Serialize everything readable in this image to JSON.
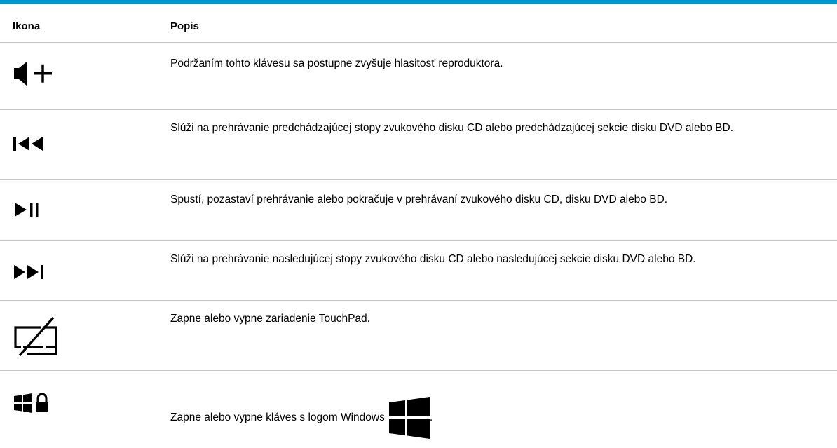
{
  "table": {
    "headers": {
      "icon": "Ikona",
      "description": "Popis"
    },
    "rows": [
      {
        "icon": "volume-up-icon",
        "description": "Podržaním tohto klávesu sa postupne zvyšuje hlasitosť reproduktora."
      },
      {
        "icon": "previous-track-icon",
        "description": "Slúži na prehrávanie predchádzajúcej stopy zvukového disku CD alebo predchádzajúcej sekcie disku DVD alebo BD."
      },
      {
        "icon": "play-pause-icon",
        "description": "Spustí, pozastaví prehrávanie alebo pokračuje v prehrávaní zvukového disku CD, disku DVD alebo BD."
      },
      {
        "icon": "next-track-icon",
        "description": "Slúži na prehrávanie nasledujúcej stopy zvukového disku CD alebo nasledujúcej sekcie disku DVD alebo BD."
      },
      {
        "icon": "touchpad-off-icon",
        "description": "Zapne alebo vypne zariadenie TouchPad."
      },
      {
        "icon": "windows-lock-icon",
        "description": "Zapne alebo vypne kláves s logom Windows",
        "suffix": "."
      }
    ]
  },
  "colors": {
    "accent": "#0096d6",
    "divider": "#c8c8c8",
    "text": "#000000"
  }
}
